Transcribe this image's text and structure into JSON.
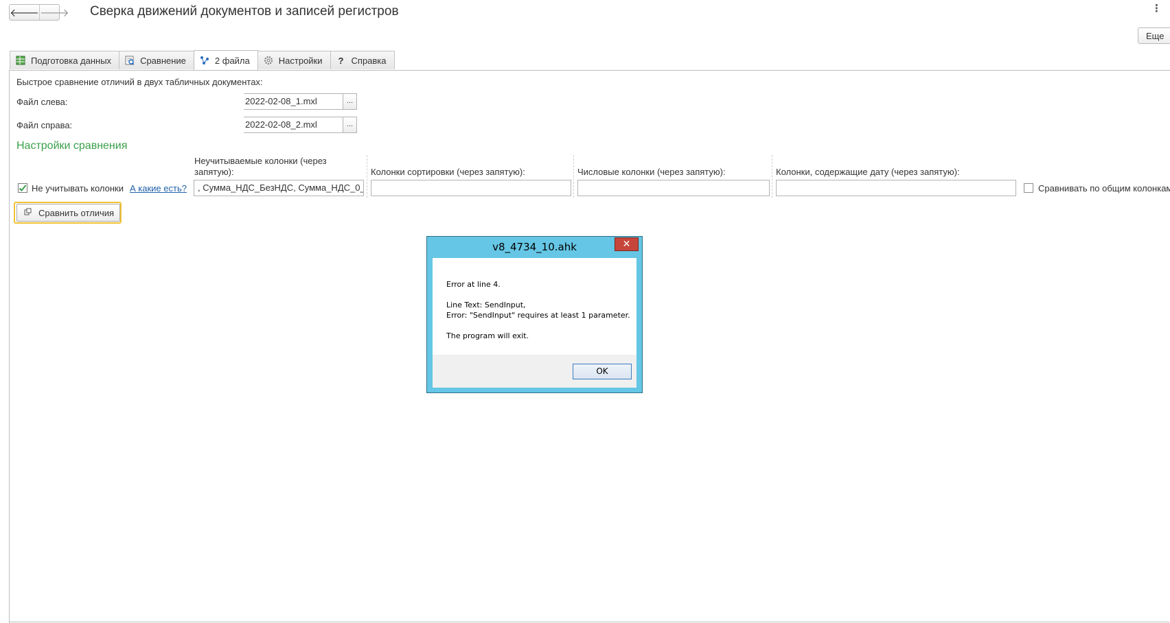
{
  "header": {
    "back_label": "🡐",
    "forward_label": "🡒",
    "title": "Сверка движений документов и записей регистров",
    "more_label": "Еще",
    "kebab": "⋮"
  },
  "tabs": [
    {
      "label": "Подготовка данных",
      "icon": "table-icon"
    },
    {
      "label": "Сравнение",
      "icon": "compare-icon"
    },
    {
      "label": "2 файла",
      "icon": "structure-icon"
    },
    {
      "label": "Настройки",
      "icon": "gear-icon"
    },
    {
      "label": "Справка",
      "icon": "question-icon"
    }
  ],
  "form": {
    "intro": "Быстрое сравнение отличий в двух табличных документах:",
    "file_left_label": "Файл слева:",
    "file_left_value": "2022-02-08_1.mxl",
    "file_right_label": "Файл справа:",
    "file_right_value": "2022-02-08_2.mxl",
    "ellipsis": "...",
    "section_title": "Настройки сравнения",
    "ignore_cols_header": "Неучитываемые колонки (через запятую):",
    "sort_cols_header": "Колонки сортировки (через запятую):",
    "num_cols_header": "Числовые колонки (через запятую):",
    "date_cols_header": "Колонки, содержащие дату (через запятую):",
    "ignore_checkbox_label": "Не учитывать колонки",
    "which_link": "А какие есть?",
    "ignore_cols_value": ", Сумма_НДС_БезНДС, Сумма_НДС_0_",
    "compare_common_label": "Сравнивать по общим колонкам",
    "compare_button": "Сравнить отличия"
  },
  "dialog": {
    "title": "v8_4734_10.ahk",
    "close": "✕",
    "line1": "Error at line 4.",
    "line2": "Line Text: SendInput,",
    "line3": "Error: \"SendInput\" requires at least 1 parameter.",
    "line4": "The program will exit.",
    "ok": "OK"
  },
  "colors": {
    "section_green": "#3aa04a",
    "link_blue": "#1d5fa8",
    "dialog_frame": "#65c6e5",
    "close_red": "#c7463b",
    "focus_yellow": "#f1c232"
  }
}
